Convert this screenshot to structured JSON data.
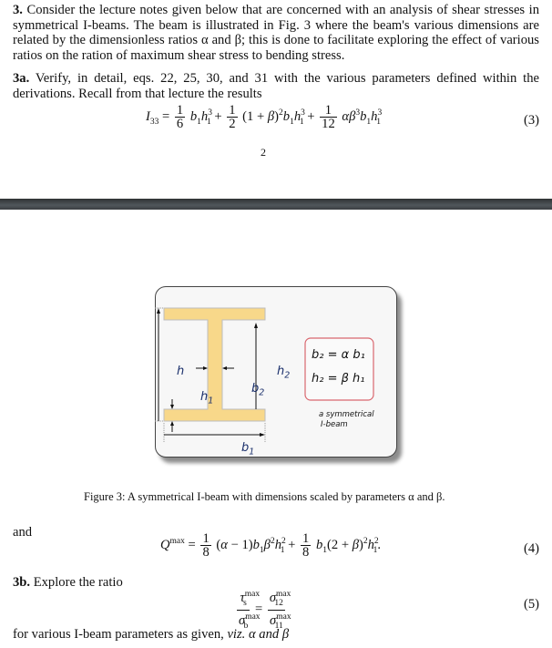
{
  "problem": {
    "number": "3.",
    "intro": "Consider the lecture notes given below that are concerned with an analysis of shear stresses in symmetrical I-beams. The beam is illustrated in Fig. 3 where the beam's various dimensions are related by the dimensionless ratios α and β; this is done to facilitate exploring the effect of various ratios on the ration of maximum shear stress to bending stress."
  },
  "part_a": {
    "label": "3a.",
    "text": "Verify, in detail, eqs. 22, 25, 30, and 31 with the various parameters defined within the derivations. Recall from that lecture the results"
  },
  "eq3": {
    "lhs": "I",
    "lhs_sub": "33",
    "number": "(3)",
    "fracs": [
      "1",
      "6",
      "1",
      "2",
      "1",
      "12"
    ]
  },
  "page_number": "2",
  "figure": {
    "labels": {
      "h": "h",
      "h1": "h",
      "h1_sub": "1",
      "h2": "h",
      "h2_sub": "2",
      "b1": "b",
      "b1_sub": "1",
      "b2": "b",
      "b2_sub": "2"
    },
    "relations": [
      "b₂ = α b₁",
      "h₂ = β h₁"
    ],
    "note_line1": "a symmetrical",
    "note_line2": "I-beam",
    "caption": "Figure 3: A symmetrical I-beam with dimensions scaled by parameters α and β.",
    "colors": {
      "beam_fill": "#f8d88a",
      "beam_edge": "#bdbdbd",
      "box_border": "#d9676f",
      "label_blue": "#1a2f6b"
    }
  },
  "and_label": "and",
  "eq4": {
    "lhs": "Q",
    "lhs_sup": "max",
    "number": "(4)",
    "fracs": [
      "1",
      "8",
      "1",
      "8"
    ]
  },
  "part_b": {
    "label": "3b.",
    "text": "Explore the ratio",
    "eq_number": "(5)",
    "after_text": "for various I-beam parameters as given,",
    "viz": "viz.",
    "tail": "α and β"
  }
}
